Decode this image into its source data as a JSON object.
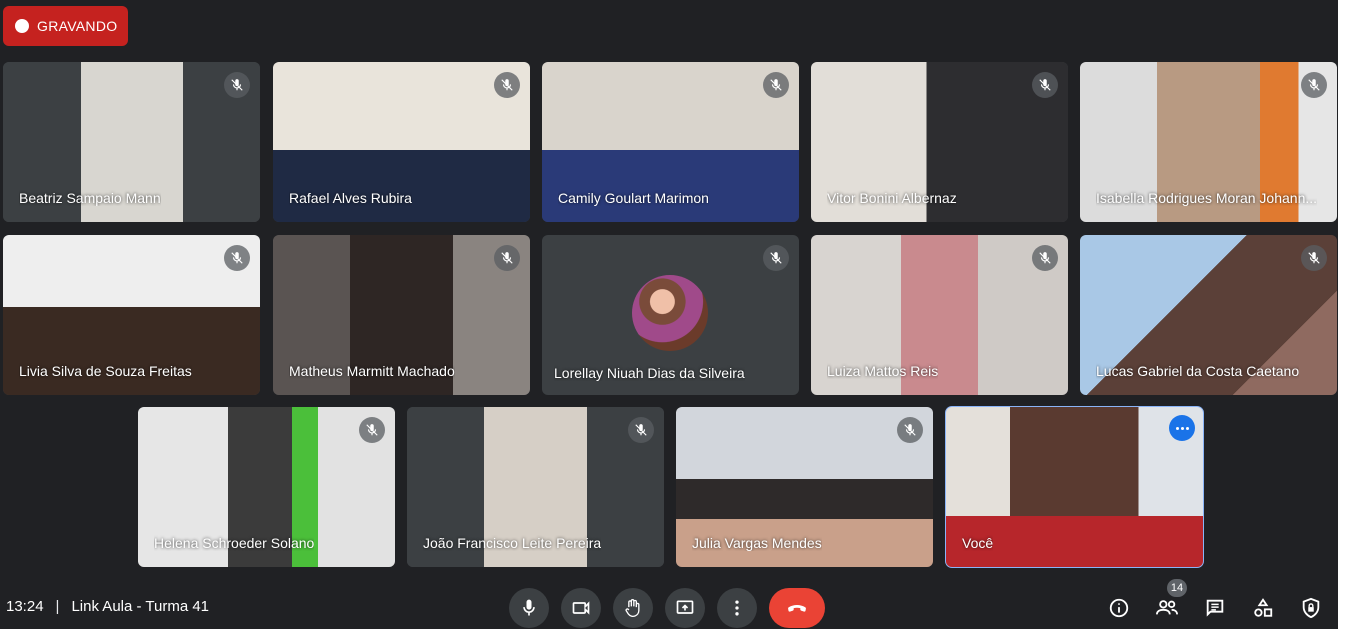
{
  "recording": {
    "label": "GRAVANDO"
  },
  "participants": [
    {
      "name": "Beatriz Sampaio Mann"
    },
    {
      "name": "Rafael Alves Rubira"
    },
    {
      "name": "Camily Goulart Marimon"
    },
    {
      "name": "Vitor Bonini Albernaz"
    },
    {
      "name": "Isabella Rodrigues Moran Johann..."
    },
    {
      "name": "Livia Silva de Souza Freitas"
    },
    {
      "name": "Matheus Marmitt Machado"
    },
    {
      "name": "Lorellay Niuah Dias da Silveira"
    },
    {
      "name": "Luiza Mattos Reis"
    },
    {
      "name": "Lucas Gabriel da Costa Caetano"
    },
    {
      "name": "Helena Schroeder Solano"
    },
    {
      "name": "João Francisco Leite Pereira"
    },
    {
      "name": "Julia Vargas Mendes"
    },
    {
      "name": "Você"
    }
  ],
  "meeting": {
    "time": "13:24",
    "separator": "|",
    "title": "Link Aula - Turma 41"
  },
  "people_count": "14",
  "colors": {
    "recording": "#c5221f",
    "hangup": "#ea4335",
    "self_border": "#8ab4f8",
    "more_button": "#1a73e8"
  },
  "icons": [
    "mic-icon",
    "camera-icon",
    "hand-icon",
    "present-icon",
    "more-vert-icon",
    "hangup-icon",
    "info-icon",
    "people-icon",
    "chat-icon",
    "activities-icon",
    "lock-icon",
    "mic-off-icon"
  ]
}
